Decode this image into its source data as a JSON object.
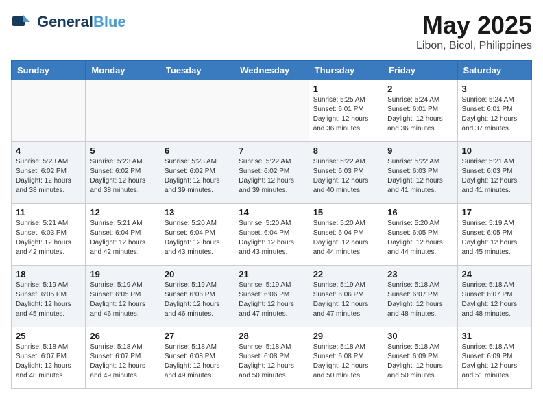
{
  "header": {
    "logo_general": "General",
    "logo_blue": "Blue",
    "month_year": "May 2025",
    "location": "Libon, Bicol, Philippines"
  },
  "weekdays": [
    "Sunday",
    "Monday",
    "Tuesday",
    "Wednesday",
    "Thursday",
    "Friday",
    "Saturday"
  ],
  "weeks": [
    [
      {
        "day": "",
        "info": ""
      },
      {
        "day": "",
        "info": ""
      },
      {
        "day": "",
        "info": ""
      },
      {
        "day": "",
        "info": ""
      },
      {
        "day": "1",
        "info": "Sunrise: 5:25 AM\nSunset: 6:01 PM\nDaylight: 12 hours\nand 36 minutes."
      },
      {
        "day": "2",
        "info": "Sunrise: 5:24 AM\nSunset: 6:01 PM\nDaylight: 12 hours\nand 36 minutes."
      },
      {
        "day": "3",
        "info": "Sunrise: 5:24 AM\nSunset: 6:01 PM\nDaylight: 12 hours\nand 37 minutes."
      }
    ],
    [
      {
        "day": "4",
        "info": "Sunrise: 5:23 AM\nSunset: 6:02 PM\nDaylight: 12 hours\nand 38 minutes."
      },
      {
        "day": "5",
        "info": "Sunrise: 5:23 AM\nSunset: 6:02 PM\nDaylight: 12 hours\nand 38 minutes."
      },
      {
        "day": "6",
        "info": "Sunrise: 5:23 AM\nSunset: 6:02 PM\nDaylight: 12 hours\nand 39 minutes."
      },
      {
        "day": "7",
        "info": "Sunrise: 5:22 AM\nSunset: 6:02 PM\nDaylight: 12 hours\nand 39 minutes."
      },
      {
        "day": "8",
        "info": "Sunrise: 5:22 AM\nSunset: 6:03 PM\nDaylight: 12 hours\nand 40 minutes."
      },
      {
        "day": "9",
        "info": "Sunrise: 5:22 AM\nSunset: 6:03 PM\nDaylight: 12 hours\nand 41 minutes."
      },
      {
        "day": "10",
        "info": "Sunrise: 5:21 AM\nSunset: 6:03 PM\nDaylight: 12 hours\nand 41 minutes."
      }
    ],
    [
      {
        "day": "11",
        "info": "Sunrise: 5:21 AM\nSunset: 6:03 PM\nDaylight: 12 hours\nand 42 minutes."
      },
      {
        "day": "12",
        "info": "Sunrise: 5:21 AM\nSunset: 6:04 PM\nDaylight: 12 hours\nand 42 minutes."
      },
      {
        "day": "13",
        "info": "Sunrise: 5:20 AM\nSunset: 6:04 PM\nDaylight: 12 hours\nand 43 minutes."
      },
      {
        "day": "14",
        "info": "Sunrise: 5:20 AM\nSunset: 6:04 PM\nDaylight: 12 hours\nand 43 minutes."
      },
      {
        "day": "15",
        "info": "Sunrise: 5:20 AM\nSunset: 6:04 PM\nDaylight: 12 hours\nand 44 minutes."
      },
      {
        "day": "16",
        "info": "Sunrise: 5:20 AM\nSunset: 6:05 PM\nDaylight: 12 hours\nand 44 minutes."
      },
      {
        "day": "17",
        "info": "Sunrise: 5:19 AM\nSunset: 6:05 PM\nDaylight: 12 hours\nand 45 minutes."
      }
    ],
    [
      {
        "day": "18",
        "info": "Sunrise: 5:19 AM\nSunset: 6:05 PM\nDaylight: 12 hours\nand 45 minutes."
      },
      {
        "day": "19",
        "info": "Sunrise: 5:19 AM\nSunset: 6:05 PM\nDaylight: 12 hours\nand 46 minutes."
      },
      {
        "day": "20",
        "info": "Sunrise: 5:19 AM\nSunset: 6:06 PM\nDaylight: 12 hours\nand 46 minutes."
      },
      {
        "day": "21",
        "info": "Sunrise: 5:19 AM\nSunset: 6:06 PM\nDaylight: 12 hours\nand 47 minutes."
      },
      {
        "day": "22",
        "info": "Sunrise: 5:19 AM\nSunset: 6:06 PM\nDaylight: 12 hours\nand 47 minutes."
      },
      {
        "day": "23",
        "info": "Sunrise: 5:18 AM\nSunset: 6:07 PM\nDaylight: 12 hours\nand 48 minutes."
      },
      {
        "day": "24",
        "info": "Sunrise: 5:18 AM\nSunset: 6:07 PM\nDaylight: 12 hours\nand 48 minutes."
      }
    ],
    [
      {
        "day": "25",
        "info": "Sunrise: 5:18 AM\nSunset: 6:07 PM\nDaylight: 12 hours\nand 48 minutes."
      },
      {
        "day": "26",
        "info": "Sunrise: 5:18 AM\nSunset: 6:07 PM\nDaylight: 12 hours\nand 49 minutes."
      },
      {
        "day": "27",
        "info": "Sunrise: 5:18 AM\nSunset: 6:08 PM\nDaylight: 12 hours\nand 49 minutes."
      },
      {
        "day": "28",
        "info": "Sunrise: 5:18 AM\nSunset: 6:08 PM\nDaylight: 12 hours\nand 50 minutes."
      },
      {
        "day": "29",
        "info": "Sunrise: 5:18 AM\nSunset: 6:08 PM\nDaylight: 12 hours\nand 50 minutes."
      },
      {
        "day": "30",
        "info": "Sunrise: 5:18 AM\nSunset: 6:09 PM\nDaylight: 12 hours\nand 50 minutes."
      },
      {
        "day": "31",
        "info": "Sunrise: 5:18 AM\nSunset: 6:09 PM\nDaylight: 12 hours\nand 51 minutes."
      }
    ]
  ]
}
